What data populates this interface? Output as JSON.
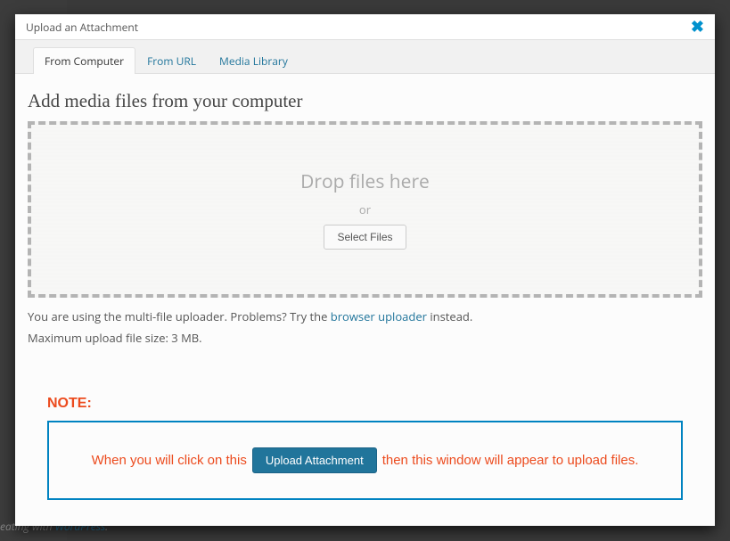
{
  "modal": {
    "title": "Upload an Attachment"
  },
  "tabs": {
    "from_computer": "From Computer",
    "from_url": "From URL",
    "media_library": "Media Library"
  },
  "heading": "Add media files from your computer",
  "dropzone": {
    "main_text": "Drop files here",
    "or_text": "or",
    "select_button": "Select Files"
  },
  "helper": {
    "prefix": "You are using the multi-file uploader. Problems? Try the ",
    "link": "browser uploader",
    "suffix": " instead."
  },
  "max_size_text": "Maximum upload file size: 3 MB.",
  "note": {
    "label": "NOTE:",
    "before": "When you will click on this",
    "button": "Upload Attachment",
    "after": "then this window will appear to upload files."
  },
  "footer": {
    "prefix": "eating with ",
    "link": "WordPress",
    "suffix": "."
  }
}
